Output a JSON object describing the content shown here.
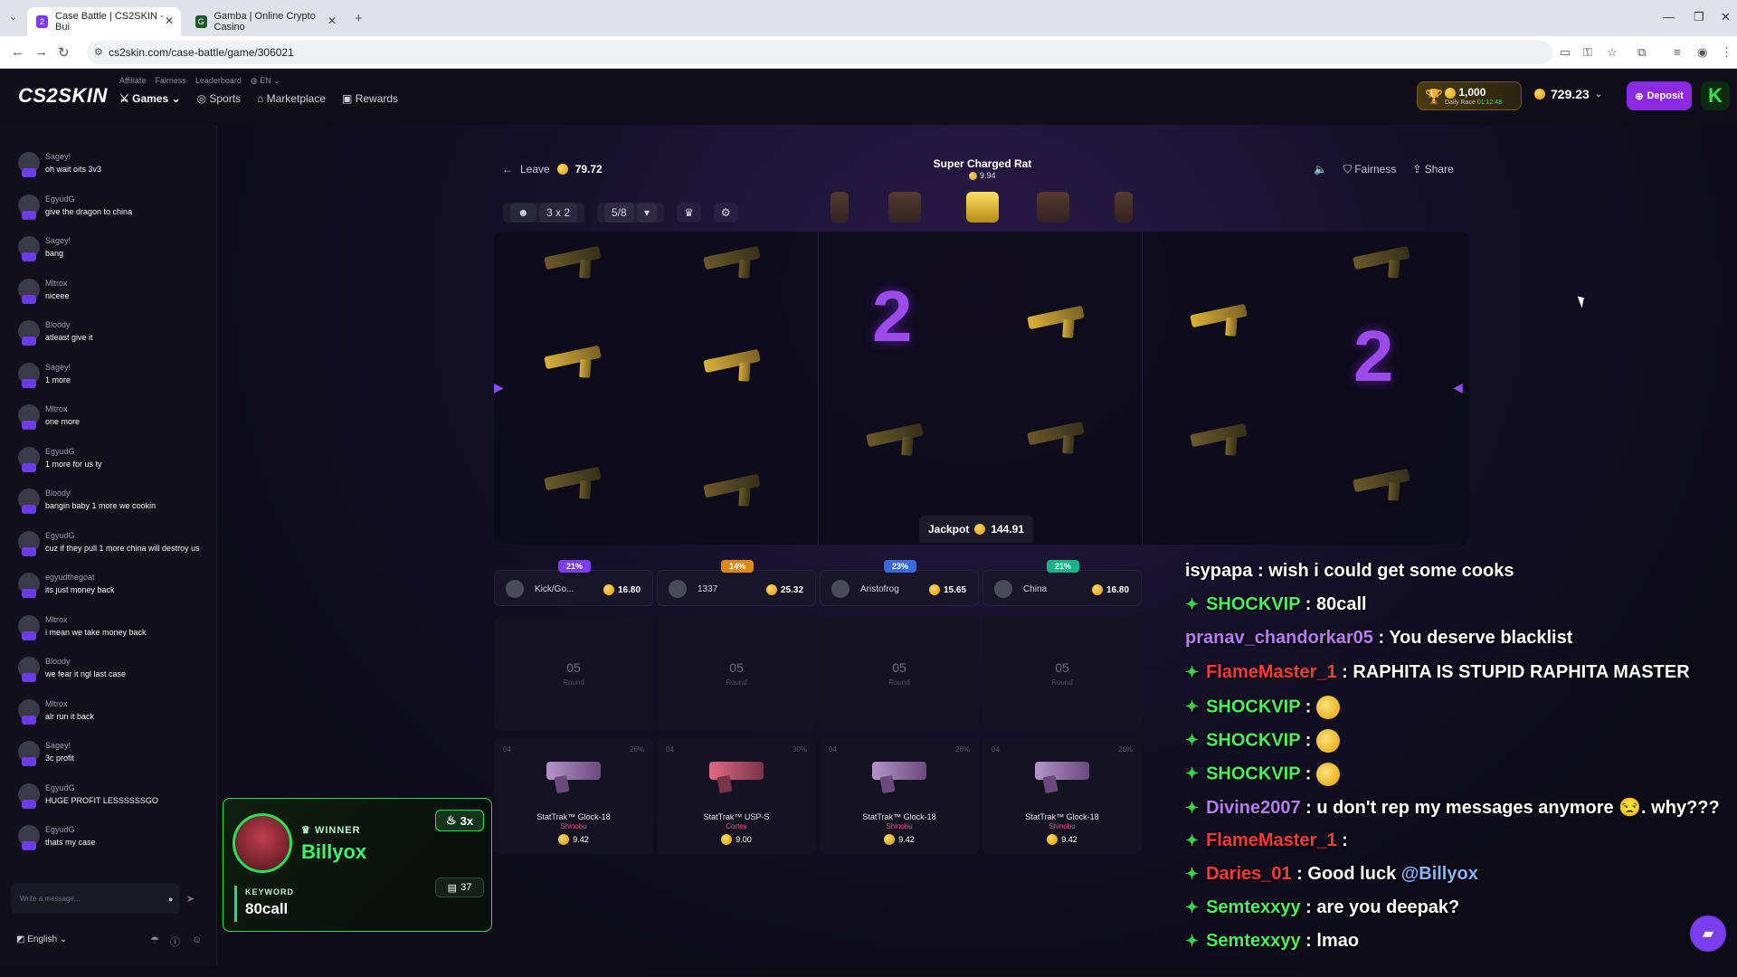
{
  "browser": {
    "tabs": [
      {
        "title": "Case Battle | CS2SKIN - Bui",
        "active": true
      },
      {
        "title": "Gamba | Online Crypto Casino",
        "active": false
      }
    ],
    "url": "cs2skin.com/case-battle/game/306021"
  },
  "header": {
    "logo": "CS2SKIN",
    "toplinks": [
      "Affiliate",
      "Fairness",
      "Leaderboard",
      "EN"
    ],
    "nav": [
      "Games",
      "Sports",
      "Marketplace",
      "Rewards"
    ],
    "daily_race": {
      "amount": "1,000",
      "label": "Daily Race",
      "timer": "01:12:48"
    },
    "balance": "729.23",
    "deposit": "Deposit",
    "avatar_letter": "K"
  },
  "chat": {
    "messages": [
      {
        "user": "Sagey!",
        "text": "oh wait oits 3v3"
      },
      {
        "user": "EgyudG",
        "text": "give the dragon to china"
      },
      {
        "user": "Sagey!",
        "text": "bang"
      },
      {
        "user": "Mltrox",
        "text": "niceee"
      },
      {
        "user": "Bloody",
        "text": "atleast give it"
      },
      {
        "user": "Sagey!",
        "text": "1 more"
      },
      {
        "user": "Mltrox",
        "text": "one more"
      },
      {
        "user": "EgyudG",
        "text": "1 more for us ty"
      },
      {
        "user": "Bloody",
        "text": "bangin baby 1 more we cookin"
      },
      {
        "user": "EgyudG",
        "text": "cuz if they pull 1 more china will destroy us"
      },
      {
        "user": "egyudthegoat",
        "text": "its just money back"
      },
      {
        "user": "Mltrox",
        "text": "i mean we take money back"
      },
      {
        "user": "Bloody",
        "text": "we fear it ngl last case"
      },
      {
        "user": "Mltrox",
        "text": "alr run it back"
      },
      {
        "user": "Sagey!",
        "text": "3c profit"
      },
      {
        "user": "EgyudG",
        "text": "HUGE PROFIT LESSSSSSGO"
      },
      {
        "user": "EgyudG",
        "text": "thats my case"
      }
    ],
    "input_placeholder": "Write a message...",
    "language": "English"
  },
  "battle": {
    "leave": "Leave",
    "total_cost": "79.72",
    "case_name": "Super Charged Rat",
    "case_price": "9.94",
    "fairness": "Fairness",
    "share": "Share",
    "mode": "3 x 2",
    "round": "5/8",
    "jackpot_label": "Jackpot",
    "jackpot_value": "144.91",
    "players": [
      {
        "name": "Kick/Go...",
        "value": "16.80",
        "pct": "21%",
        "pct_color": "#7b3df0"
      },
      {
        "name": "1337",
        "value": "25.32",
        "pct": "14%",
        "pct_color": "#d98a1a"
      },
      {
        "name": "Aristofrog",
        "value": "15.65",
        "pct": "23%",
        "pct_color": "#3a6ae0"
      },
      {
        "name": "China",
        "value": "16.80",
        "pct": "21%",
        "pct_color": "#19b38a"
      }
    ],
    "round_label": "Round",
    "round_number": "05",
    "drops": [
      {
        "name": "StatTrak™ Glock-18",
        "skin": "Shinobu",
        "price": "9.42",
        "round": "04",
        "chance": "26%"
      },
      {
        "name": "StatTrak™ USP-S",
        "skin": "Cortex",
        "price": "9.00",
        "round": "04",
        "chance": "30%"
      },
      {
        "name": "StatTrak™ Glock-18",
        "skin": "Shinobu",
        "price": "9.42",
        "round": "04",
        "chance": "26%"
      },
      {
        "name": "StatTrak™ Glock-18",
        "skin": "Shinobu",
        "price": "9.42",
        "round": "04",
        "chance": "26%"
      }
    ]
  },
  "winner": {
    "label": "WINNER",
    "name": "Billyox",
    "multiplier": "3x",
    "keyword_label": "KEYWORD",
    "keyword": "80call",
    "tickets": "37"
  },
  "stream_chat": [
    {
      "user": "isypapa",
      "sep": " : ",
      "text": "wish i could get some cooks",
      "color": "#ffffff",
      "star": false
    },
    {
      "user": "SHOCKVIP",
      "sep": " : ",
      "text": "80call",
      "color": "#4ef060",
      "star": true
    },
    {
      "user": "pranav_chandorkar05",
      "sep": " : ",
      "text": "You deserve blacklist",
      "color": "#b57cff",
      "star": false
    },
    {
      "user": "FlameMaster_1",
      "sep": " : ",
      "text": "RAPHITA IS STUPID RAPHITA MASTER",
      "color": "#ff3b3b",
      "star": true
    },
    {
      "user": "SHOCKVIP",
      "sep": " : ",
      "text": "",
      "color": "#4ef060",
      "star": true,
      "emoji": true
    },
    {
      "user": "SHOCKVIP",
      "sep": " : ",
      "text": "",
      "color": "#4ef060",
      "star": true,
      "emoji": true
    },
    {
      "user": "SHOCKVIP",
      "sep": " : ",
      "text": "",
      "color": "#4ef060",
      "star": true,
      "emoji": true
    },
    {
      "user": "Divine2007",
      "sep": " : ",
      "text": "u don't rep my messages anymore 😒. why???",
      "color": "#b57cff",
      "star": true
    },
    {
      "user": "FlameMaster_1",
      "sep": " : ",
      "text": "",
      "color": "#ff3b3b",
      "star": true
    },
    {
      "user": "Daries_01",
      "sep": " : ",
      "text": "Good luck ",
      "mention": "@Billyox",
      "color": "#ff3b3b",
      "star": true
    },
    {
      "user": "Semtexxyy",
      "sep": " : ",
      "text": "are you deepak?",
      "color": "#4ef060",
      "star": true
    },
    {
      "user": "Semtexxyy",
      "sep": " : ",
      "text": "lmao",
      "color": "#4ef060",
      "star": true
    }
  ],
  "colors": {
    "accent": "#8a2be2",
    "win_green": "#23e05a",
    "coin": "#f5b40a"
  }
}
